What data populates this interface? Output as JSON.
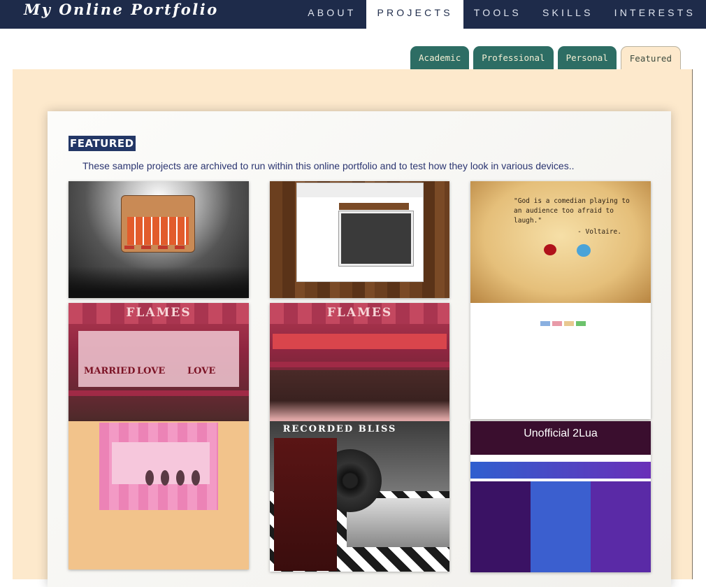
{
  "brand": "My Online Portfolio",
  "nav": [
    {
      "label": "ABOUT",
      "active": false
    },
    {
      "label": "PROJECTS",
      "active": true
    },
    {
      "label": "TOOLS",
      "active": false
    },
    {
      "label": "SKILLS",
      "active": false
    },
    {
      "label": "INTERESTS",
      "active": false
    }
  ],
  "tabs": [
    {
      "label": "Academic",
      "active": false
    },
    {
      "label": "Professional",
      "active": false
    },
    {
      "label": "Personal",
      "active": false
    },
    {
      "label": "Featured",
      "active": true
    }
  ],
  "featured": {
    "heading": "FEATURED",
    "intro": "These sample projects are archived to run within this online portfolio and to test how they look in various devices.."
  },
  "thumbnails": {
    "voltaire": {
      "quote": "\"God is a comedian playing to an audience too afraid to laugh.\"",
      "author": "- Voltaire."
    },
    "flames_1": {
      "title": "FLAMES",
      "result_1": "MARRIED",
      "result_2": "LOVE",
      "result_3": "LOVE"
    },
    "flames_2": {
      "title": "FLAMES"
    },
    "recorded_bliss": {
      "title": "RECORDED BLISS"
    },
    "lua": {
      "title": "Unofficial 2Lua"
    }
  },
  "colors": {
    "nav_bg": "#1e2b4a",
    "tab_bg": "#2d6d64",
    "panel_bg": "#fde9cc",
    "heading_bg": "#233766",
    "intro_text": "#2a3470"
  }
}
